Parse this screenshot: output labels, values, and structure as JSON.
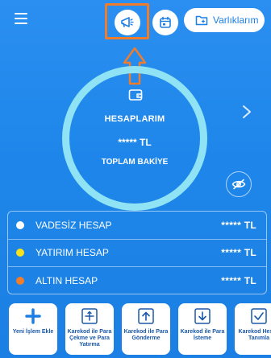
{
  "header": {
    "menu_icon": "hamburger-icon",
    "announce_icon": "megaphone-icon",
    "calendar_icon": "calendar-icon",
    "assets_button_label": "Varlıklarım",
    "assets_icon": "folder-icon"
  },
  "annotation": {
    "highlight_color": "#f07d2c"
  },
  "balance": {
    "accounts_label": "HESAPLARIM",
    "total_amount": "***** TL",
    "total_label": "TOPLAM BAKİYE",
    "ring_color": "#8fe3f4"
  },
  "accounts": [
    {
      "name": "VADESİZ HESAP",
      "balance": "***** TL",
      "color": "#ffffff"
    },
    {
      "name": "YATIRIM HESAP",
      "balance": "***** TL",
      "color": "#f4e21c"
    },
    {
      "name": "ALTIN HESAP",
      "balance": "***** TL",
      "color": "#f07d2c"
    }
  ],
  "actions": [
    {
      "label": "Yeni İşlem Ekle",
      "icon": "plus-icon"
    },
    {
      "label": "Karekod ile Para Çekme ve Para Yatırma",
      "icon": "qr-withdraw-icon"
    },
    {
      "label": "Karekod ile Para Gönderme",
      "icon": "qr-send-icon"
    },
    {
      "label": "Karekod ile Para İsteme",
      "icon": "qr-request-icon"
    },
    {
      "label": "Karekod Hesap Tanımla",
      "icon": "qr-define-icon"
    }
  ],
  "colors": {
    "background": "#1e86ea",
    "action_text": "#1a58a8"
  }
}
